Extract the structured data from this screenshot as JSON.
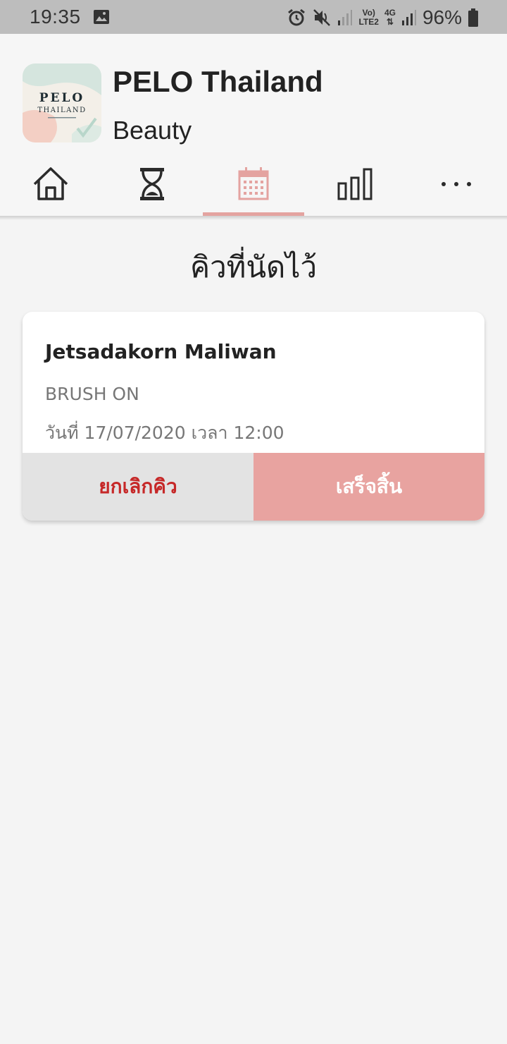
{
  "status_bar": {
    "time": "19:35",
    "battery": "96%",
    "net_top": "Vo)",
    "net_bottom": "LTE2",
    "net_4g": "4G",
    "icons": [
      "gallery-icon",
      "alarm-icon",
      "mute-icon",
      "signal-icon",
      "battery-icon"
    ]
  },
  "header": {
    "title": "PELO Thailand",
    "category": "Beauty",
    "logo": {
      "line1": "PELO",
      "line2": "THAILAND"
    }
  },
  "tabs": [
    {
      "name": "home",
      "icon": "home-icon",
      "active": false
    },
    {
      "name": "queue",
      "icon": "hourglass-icon",
      "active": false
    },
    {
      "name": "appointments",
      "icon": "calendar-icon",
      "active": true
    },
    {
      "name": "stats",
      "icon": "bar-chart-icon",
      "active": false
    },
    {
      "name": "more",
      "icon": "more-icon",
      "active": false
    }
  ],
  "page": {
    "title": "คิวที่นัดไว้"
  },
  "appointments": [
    {
      "customer": "Jetsadakorn Maliwan",
      "service": "BRUSH ON",
      "datetime": "วันที่ 17/07/2020 เวลา 12:00",
      "cancel_label": "ยกเลิกคิว",
      "done_label": "เสร็จสิ้น"
    }
  ],
  "colors": {
    "accent": "#e4a3a0",
    "cancel_text": "#c62828",
    "cancel_bg": "#e3e3e3",
    "done_bg": "#e8a3a0"
  }
}
